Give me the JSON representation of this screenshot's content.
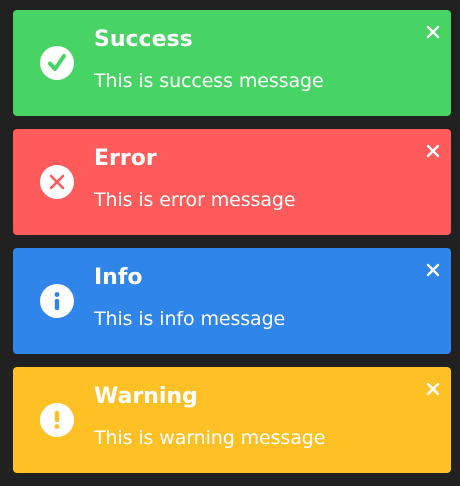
{
  "toasts": [
    {
      "type": "success",
      "title": "Success",
      "message": "This is success message",
      "icon": "check-icon",
      "color": "#48d365"
    },
    {
      "type": "error",
      "title": "Error",
      "message": "This is error message",
      "icon": "x-icon",
      "color": "#fe5b5a"
    },
    {
      "type": "info",
      "title": "Info",
      "message": "This is info message",
      "icon": "info-icon",
      "color": "#2f85e9"
    },
    {
      "type": "warning",
      "title": "Warning",
      "message": "This is warning message",
      "icon": "exclamation-icon",
      "color": "#fdc126"
    }
  ],
  "close_icon": "close-icon",
  "background": "#212121"
}
